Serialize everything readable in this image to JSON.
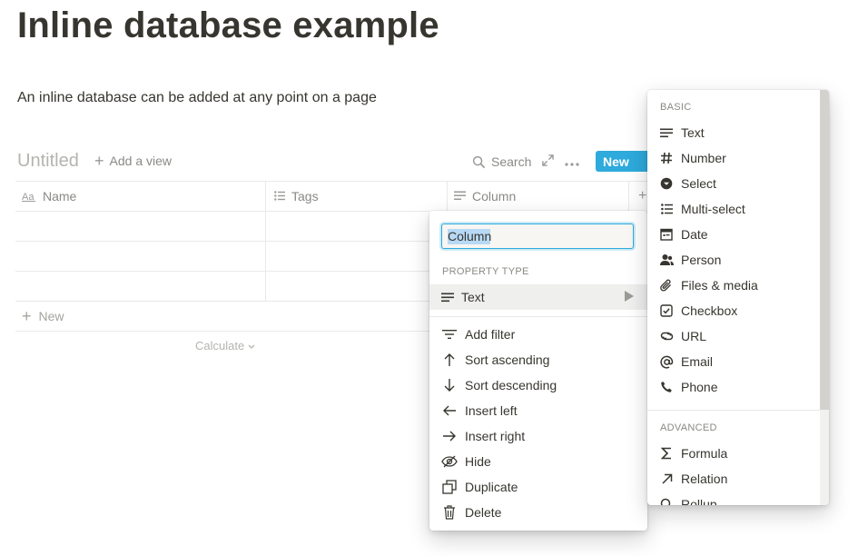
{
  "page": {
    "title": "Inline database example",
    "description": "An inline database can be added at any point on a page"
  },
  "database": {
    "title": "Untitled",
    "add_view_label": "Add a view",
    "search_label": "Search",
    "new_button_label": "New",
    "columns": [
      {
        "label": "Name",
        "icon": "title-aa-icon"
      },
      {
        "label": "Tags",
        "icon": "list-icon"
      },
      {
        "label": "Column",
        "icon": "text-lines-icon"
      }
    ],
    "new_row_label": "New",
    "calculate_label": "Calculate"
  },
  "column_menu": {
    "name_value": "Column",
    "property_type_heading": "PROPERTY TYPE",
    "current_type": "Text",
    "items": [
      {
        "label": "Add filter",
        "icon": "filter-icon"
      },
      {
        "label": "Sort ascending",
        "icon": "arrow-up-icon"
      },
      {
        "label": "Sort descending",
        "icon": "arrow-down-icon"
      },
      {
        "label": "Insert left",
        "icon": "arrow-left-icon"
      },
      {
        "label": "Insert right",
        "icon": "arrow-right-icon"
      },
      {
        "label": "Hide",
        "icon": "eye-slash-icon"
      },
      {
        "label": "Duplicate",
        "icon": "duplicate-icon"
      },
      {
        "label": "Delete",
        "icon": "trash-icon"
      }
    ]
  },
  "type_menu": {
    "basic_heading": "BASIC",
    "basic": [
      {
        "label": "Text",
        "icon": "text-lines-icon"
      },
      {
        "label": "Number",
        "icon": "hash-icon"
      },
      {
        "label": "Select",
        "icon": "select-icon"
      },
      {
        "label": "Multi-select",
        "icon": "list-icon"
      },
      {
        "label": "Date",
        "icon": "calendar-icon"
      },
      {
        "label": "Person",
        "icon": "person-icon"
      },
      {
        "label": "Files & media",
        "icon": "paperclip-icon"
      },
      {
        "label": "Checkbox",
        "icon": "checkbox-icon"
      },
      {
        "label": "URL",
        "icon": "link-icon"
      },
      {
        "label": "Email",
        "icon": "at-icon"
      },
      {
        "label": "Phone",
        "icon": "phone-icon"
      }
    ],
    "advanced_heading": "ADVANCED",
    "advanced": [
      {
        "label": "Formula",
        "icon": "sigma-icon"
      },
      {
        "label": "Relation",
        "icon": "arrow-up-right-icon"
      },
      {
        "label": "Rollup",
        "icon": "search-icon"
      }
    ]
  },
  "colors": {
    "accent": "#2eaadc",
    "text": "#37352f",
    "muted": "#8a8985"
  }
}
